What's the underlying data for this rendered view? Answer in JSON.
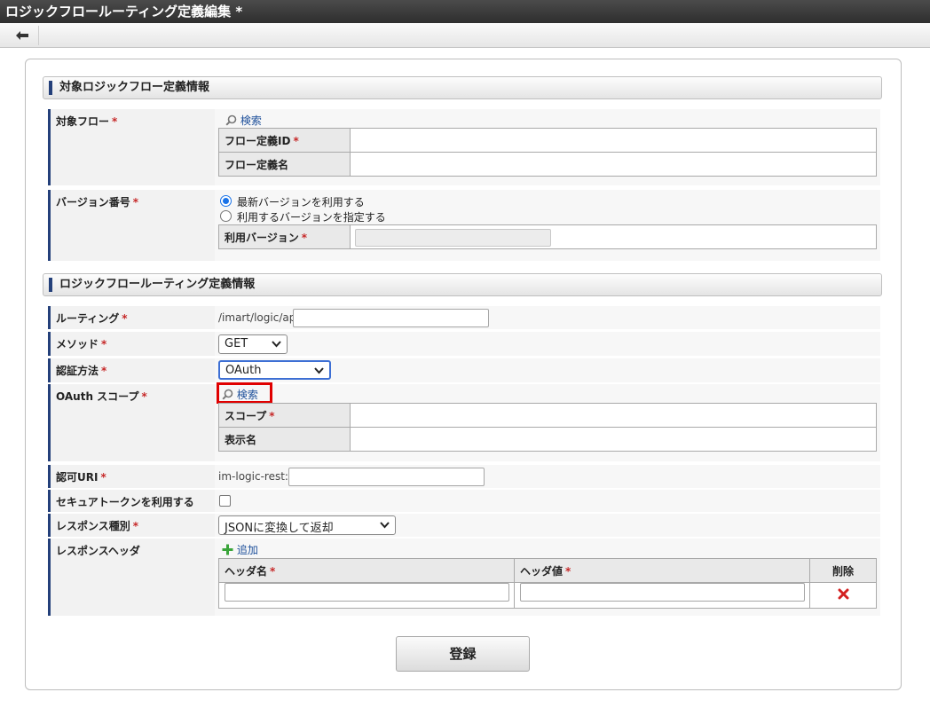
{
  "window": {
    "title": "ロジックフロールーティング定義編集 *"
  },
  "sections": {
    "target": "対象ロジックフロー定義情報",
    "routing_info": "ロジックフロールーティング定義情報"
  },
  "target_flow": {
    "label": "対象フロー",
    "search": "検索",
    "id_label": "フロー定義ID",
    "name_label": "フロー定義名"
  },
  "version": {
    "label": "バージョン番号",
    "option_latest": "最新バージョンを利用する",
    "option_specify": "利用するバージョンを指定する",
    "use_label": "利用バージョン"
  },
  "routing": {
    "label": "ルーティング",
    "prefix": "/imart/logic/api/"
  },
  "method": {
    "label": "メソッド",
    "value": "GET"
  },
  "auth": {
    "label": "認証方法",
    "value": "OAuth"
  },
  "scope": {
    "label": "OAuth スコープ",
    "search": "検索",
    "scope_label": "スコープ",
    "display_label": "表示名"
  },
  "auth_uri": {
    "label": "認可URI",
    "prefix": "im-logic-rest://"
  },
  "secure_token": {
    "label": "セキュアトークンを利用する"
  },
  "response_type": {
    "label": "レスポンス種別",
    "value": "JSONに変換して返却"
  },
  "response_header": {
    "label": "レスポンスヘッダ",
    "add": "追加",
    "col_name": "ヘッダ名",
    "col_value": "ヘッダ値",
    "col_delete": "削除"
  },
  "required_mark": "*",
  "register_button": "登録",
  "colors": {
    "accent": "#24407a",
    "required": "#c62828",
    "link": "#1d4f9a",
    "highlight": "#e00000"
  }
}
